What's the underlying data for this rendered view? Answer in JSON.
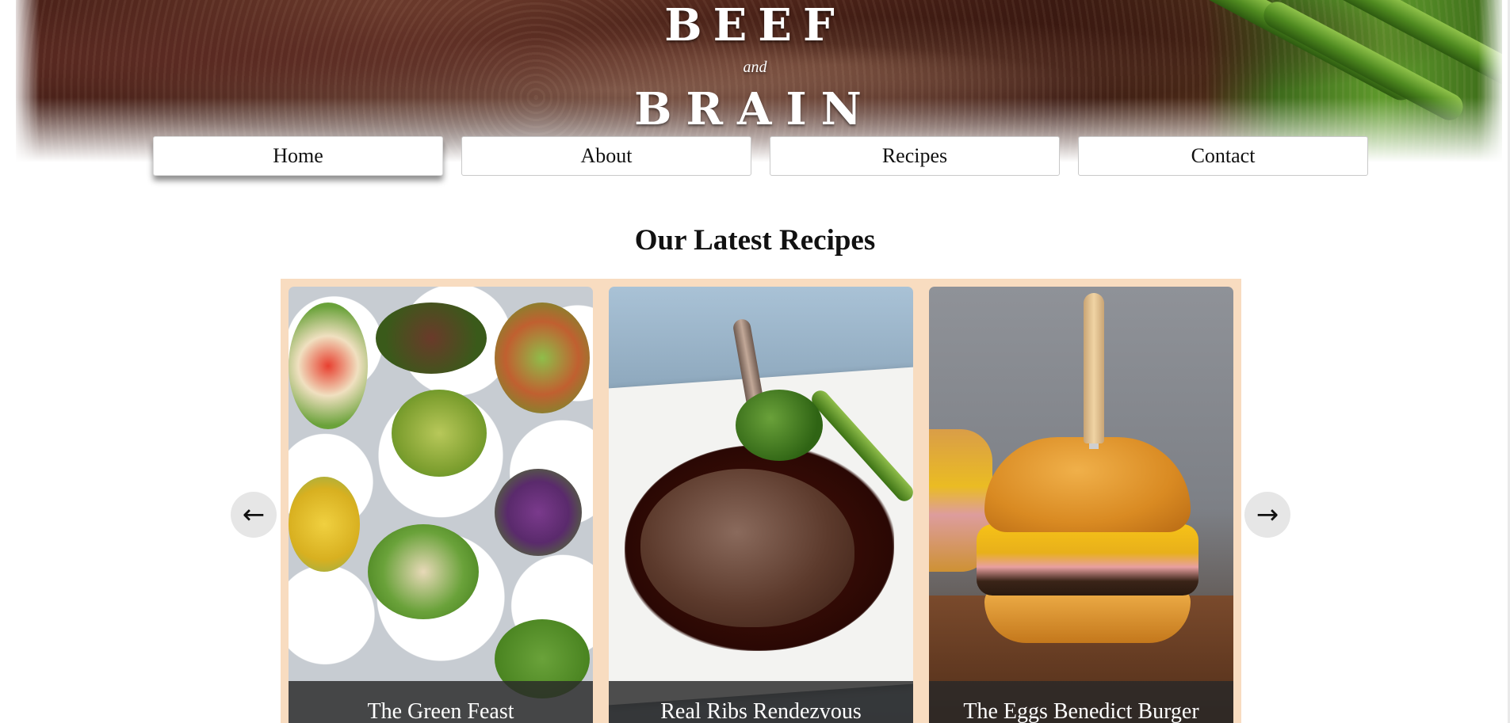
{
  "brand": {
    "word1": "BEEF",
    "conjunction": "and",
    "word2": "BRAIN"
  },
  "nav": {
    "items": [
      {
        "label": "Home",
        "active": true
      },
      {
        "label": "About",
        "active": false
      },
      {
        "label": "Recipes",
        "active": false
      },
      {
        "label": "Contact",
        "active": false
      }
    ]
  },
  "latest": {
    "title": "Our Latest Recipes",
    "prev_arrow": "←",
    "next_arrow": "→",
    "cards": [
      {
        "title": "The Green Feast",
        "image": "salad-bowls"
      },
      {
        "title": "Real Ribs Rendezvous",
        "image": "steak-plate"
      },
      {
        "title": "The Eggs Benedict Burger",
        "image": "burger"
      }
    ]
  },
  "colors": {
    "carousel_bg": "#f8dcc0",
    "caption_bg": "#282828",
    "arrow_bg": "#e6e6e6"
  }
}
